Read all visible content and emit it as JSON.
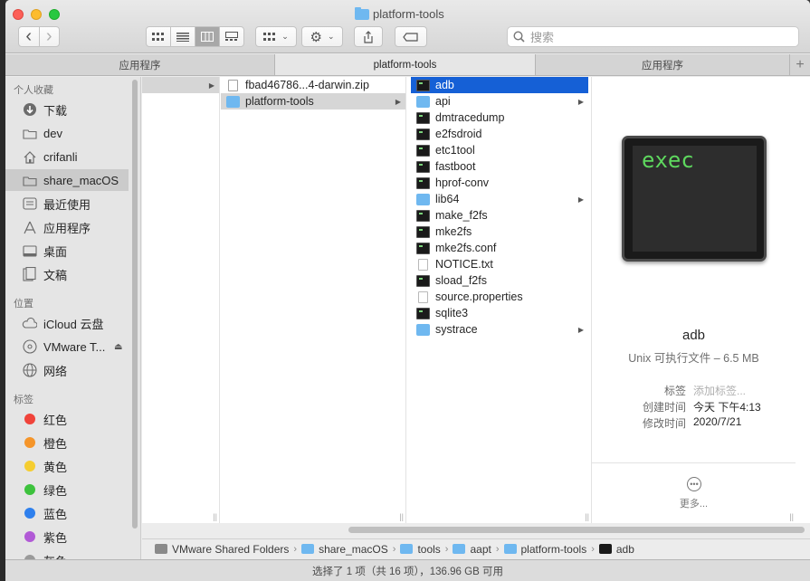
{
  "window": {
    "title": "platform-tools"
  },
  "toolbar": {
    "back_icon": "‹",
    "forward_icon": "›",
    "search_placeholder": "搜索"
  },
  "tabs": [
    {
      "label": "应用程序"
    },
    {
      "label": "platform-tools"
    },
    {
      "label": "应用程序"
    }
  ],
  "sidebar": {
    "favorites_header": "个人收藏",
    "favorites": [
      {
        "label": "下载",
        "icon": "download-icon"
      },
      {
        "label": "dev",
        "icon": "folder-icon"
      },
      {
        "label": "crifanli",
        "icon": "home-icon"
      },
      {
        "label": "share_macOS",
        "icon": "folder-icon"
      },
      {
        "label": "最近使用",
        "icon": "recents-icon"
      },
      {
        "label": "应用程序",
        "icon": "applications-icon"
      },
      {
        "label": "桌面",
        "icon": "desktop-icon"
      },
      {
        "label": "文稿",
        "icon": "documents-icon"
      }
    ],
    "locations_header": "位置",
    "locations": [
      {
        "label": "iCloud 云盘",
        "icon": "cloud-icon"
      },
      {
        "label": "VMware T...",
        "icon": "disc-icon"
      },
      {
        "label": "网络",
        "icon": "network-icon"
      }
    ],
    "tags_header": "标签",
    "tags": [
      {
        "label": "红色",
        "color": "#f0433a"
      },
      {
        "label": "橙色",
        "color": "#f5952a"
      },
      {
        "label": "黄色",
        "color": "#f5cd30"
      },
      {
        "label": "绿色",
        "color": "#3dc23d"
      },
      {
        "label": "蓝色",
        "color": "#2f80ed"
      },
      {
        "label": "紫色",
        "color": "#b15ad6"
      },
      {
        "label": "灰色",
        "color": "#9a9a9a"
      }
    ]
  },
  "column2": [
    {
      "label": "fbad46786...4-darwin.zip",
      "icon": "zip-icon"
    },
    {
      "label": "platform-tools",
      "icon": "folder-icon"
    }
  ],
  "column3": [
    {
      "label": "adb",
      "icon": "exec-icon"
    },
    {
      "label": "api",
      "icon": "folder-icon"
    },
    {
      "label": "dmtracedump",
      "icon": "exec-icon"
    },
    {
      "label": "e2fsdroid",
      "icon": "exec-icon"
    },
    {
      "label": "etc1tool",
      "icon": "exec-icon"
    },
    {
      "label": "fastboot",
      "icon": "exec-icon"
    },
    {
      "label": "hprof-conv",
      "icon": "exec-icon"
    },
    {
      "label": "lib64",
      "icon": "folder-icon"
    },
    {
      "label": "make_f2fs",
      "icon": "exec-icon"
    },
    {
      "label": "mke2fs",
      "icon": "exec-icon"
    },
    {
      "label": "mke2fs.conf",
      "icon": "exec-icon"
    },
    {
      "label": "NOTICE.txt",
      "icon": "document-icon"
    },
    {
      "label": "sload_f2fs",
      "icon": "exec-icon"
    },
    {
      "label": "source.properties",
      "icon": "document-icon"
    },
    {
      "label": "sqlite3",
      "icon": "exec-icon"
    },
    {
      "label": "systrace",
      "icon": "folder-icon"
    }
  ],
  "preview": {
    "icon_text": "exec",
    "name": "adb",
    "kind": "Unix 可执行文件 – 6.5 MB",
    "tags_label": "标签",
    "tags_placeholder": "添加标签...",
    "created_label": "创建时间",
    "created_value": "今天 下午4:13",
    "modified_label": "修改时间",
    "modified_value": "2020/7/21",
    "more_label": "更多..."
  },
  "pathbar": [
    {
      "label": "VMware Shared Folders",
      "icon": "drive-icon"
    },
    {
      "label": "share_macOS",
      "icon": "folder-icon"
    },
    {
      "label": "tools",
      "icon": "folder-icon"
    },
    {
      "label": "aapt",
      "icon": "folder-icon"
    },
    {
      "label": "platform-tools",
      "icon": "folder-icon"
    },
    {
      "label": "adb",
      "icon": "exec-icon"
    }
  ],
  "status": "选择了 1 项（共 16 项），136.96 GB 可用"
}
